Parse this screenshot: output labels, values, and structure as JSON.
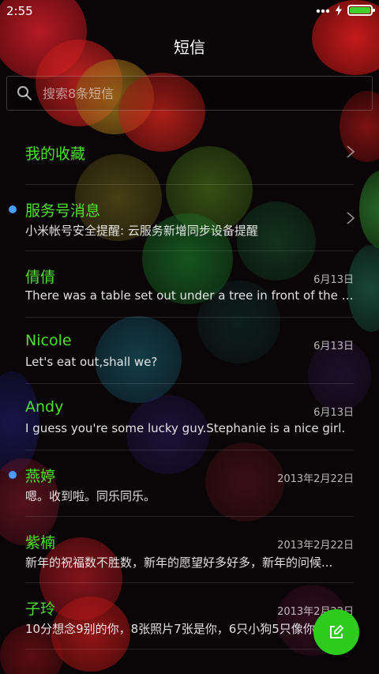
{
  "status_bar": {
    "time": "2:55",
    "signal_icon": "dots-icon",
    "charging_icon": "bolt-icon",
    "battery_icon": "battery-icon",
    "battery_color": "#3fcf2d"
  },
  "header": {
    "title": "短信"
  },
  "search": {
    "placeholder": "搜索8条短信",
    "value": ""
  },
  "favorites": {
    "label": "我的收藏"
  },
  "conversations": [
    {
      "name": "服务号消息",
      "preview": "小米帐号安全提醒: 云服务新增同步设备提醒",
      "date": "",
      "unread": true,
      "chevron": true
    },
    {
      "name": "倩倩",
      "preview": "There was a table set out under a tree in front of the house...",
      "date": "6月13日",
      "unread": false
    },
    {
      "name": "Nicole",
      "preview": "Let's eat out,shall we?",
      "date": "6月13日",
      "unread": false
    },
    {
      "name": "Andy",
      "preview": "I guess you're some lucky guy.Stephanie is a nice girl.",
      "date": "6月13日",
      "unread": false
    },
    {
      "name": "燕婷",
      "preview": "嗯。收到啦。同乐同乐。",
      "date": "2013年2月22日",
      "unread": true
    },
    {
      "name": "紫楠",
      "preview": "新年的祝福数不胜数，新年的愿望好多好多，新年的问候...",
      "date": "2013年2月22日",
      "unread": false
    },
    {
      "name": "子玲",
      "preview": "10分想念9别的你，8张照片7张是你，6只小狗5只像你...",
      "date": "2013年2月22日",
      "unread": false
    }
  ],
  "fab": {
    "icon": "compose-icon",
    "color": "#2ecb1d"
  },
  "colors": {
    "accent_green": "#4fe02f",
    "unread_dot": "#4c9bff"
  }
}
